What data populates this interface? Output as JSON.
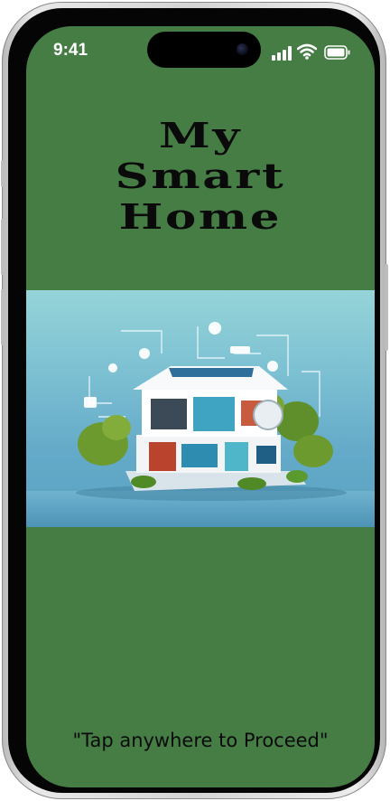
{
  "status_bar": {
    "time": "9:41",
    "icons": [
      "signal-icon",
      "wifi-icon",
      "battery-icon"
    ]
  },
  "title_lines": [
    "My",
    "Smart",
    "Home"
  ],
  "hero_image": {
    "description_icon": "smart-house-illustration"
  },
  "hint": "\"Tap anywhere to Proceed\"",
  "colors": {
    "background": "#457d45",
    "title": "#0a0a0a",
    "hero_sky": "#7cc0d2"
  }
}
